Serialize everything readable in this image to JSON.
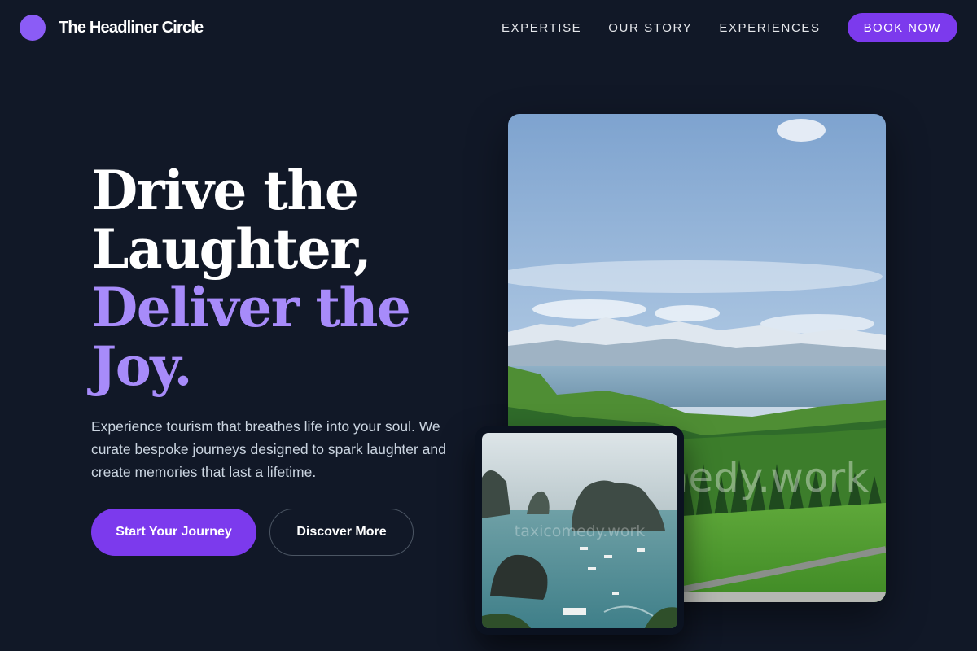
{
  "brand": {
    "name": "The Headliner Circle",
    "accent": "#8b5cf6"
  },
  "nav": {
    "links": [
      "EXPERTISE",
      "OUR STORY",
      "EXPERIENCES"
    ],
    "cta": "BOOK NOW"
  },
  "hero": {
    "title_line1": "Drive the",
    "title_line2": "Laughter,",
    "title_line3": "Deliver the",
    "title_line4": "Joy.",
    "description": "Experience tourism that breathes life into your soul. We curate bespoke journeys designed to spark laughter and create memories that last a lifetime.",
    "primary_button": "Start Your Journey",
    "secondary_button": "Discover More"
  },
  "images": {
    "main_watermark": "taxicomedy.work",
    "small_watermark": "taxicomedy.work"
  },
  "colors": {
    "background": "#111827",
    "primary": "#7c3aed",
    "highlight": "#a78bfa"
  }
}
